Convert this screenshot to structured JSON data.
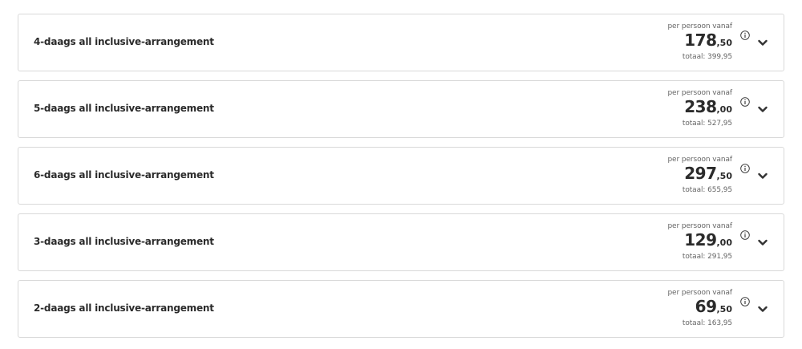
{
  "arrangements": [
    {
      "title": "4-daags all inclusive-arrangement",
      "per_person_label": "per persoon vanaf",
      "price_int": "178",
      "price_dec": ",50",
      "total": "totaal: 399,95"
    },
    {
      "title": "5-daags all inclusive-arrangement",
      "per_person_label": "per persoon vanaf",
      "price_int": "238",
      "price_dec": ",00",
      "total": "totaal: 527,95"
    },
    {
      "title": "6-daags all inclusive-arrangement",
      "per_person_label": "per persoon vanaf",
      "price_int": "297",
      "price_dec": ",50",
      "total": "totaal: 655,95"
    },
    {
      "title": "3-daags all inclusive-arrangement",
      "per_person_label": "per persoon vanaf",
      "price_int": "129",
      "price_dec": ",00",
      "total": "totaal: 291,95"
    },
    {
      "title": "2-daags all inclusive-arrangement",
      "per_person_label": "per persoon vanaf",
      "price_int": "69",
      "price_dec": ",50",
      "total": "totaal: 163,95"
    }
  ],
  "icons": {
    "info": "info-icon",
    "expand": "chevron-down-icon"
  },
  "colors": {
    "border": "#d9d9d9",
    "text": "#2b2b2b",
    "muted": "#666666"
  }
}
